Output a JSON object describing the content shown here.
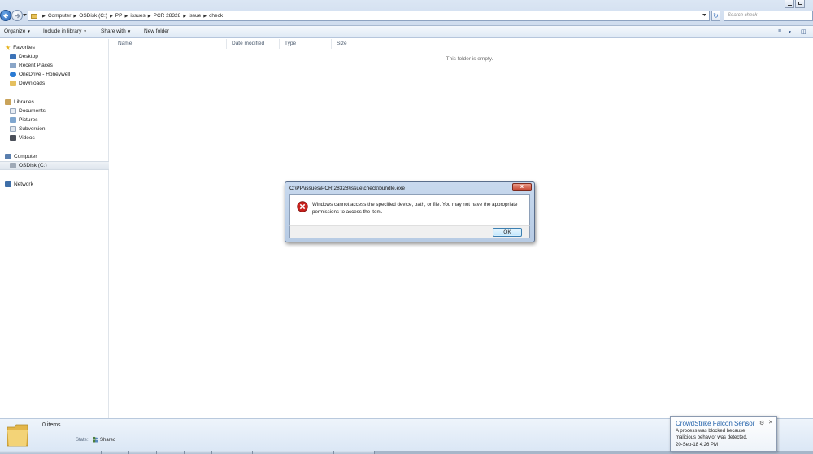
{
  "window": {
    "minimize_icon": "minimize-icon",
    "restore_icon": "restore-icon"
  },
  "address": {
    "crumbs": [
      "Computer",
      "OSDisk (C:)",
      "PP",
      "issues",
      "PCR 28328",
      "issue",
      "check"
    ],
    "search_placeholder": "Search check"
  },
  "toolbar": {
    "organize": "Organize",
    "include": "Include in library",
    "share": "Share with",
    "new_folder": "New folder"
  },
  "nav": {
    "favorites": "Favorites",
    "desktop": "Desktop",
    "recent": "Recent Places",
    "onedrive": "OneDrive - Honeywell",
    "downloads": "Downloads",
    "libraries": "Libraries",
    "documents": "Documents",
    "pictures": "Pictures",
    "subversion": "Subversion",
    "videos": "Videos",
    "computer": "Computer",
    "osdisk": "OSDisk (C:)",
    "network": "Network"
  },
  "columns": {
    "name": "Name",
    "date": "Date modified",
    "type": "Type",
    "size": "Size"
  },
  "content": {
    "empty": "This folder is empty."
  },
  "dialog": {
    "title": "C:\\PP\\issues\\PCR 28328\\issue\\check\\bundle.exe",
    "message": "Windows cannot access the specified device, path, or file.  You may not have the appropriate permissions to access the item.",
    "ok": "OK",
    "close": "x"
  },
  "details": {
    "count": "0 items",
    "state_label": "State:",
    "state_value": "Shared"
  },
  "notification": {
    "title": "CrowdStrike Falcon Sensor",
    "message": "A process was blocked because malicious behavior was detected.",
    "time": "20-Sep-18 4:26 PM"
  },
  "colors": {
    "accent": "#1f5fa8",
    "error": "#c8201c"
  }
}
